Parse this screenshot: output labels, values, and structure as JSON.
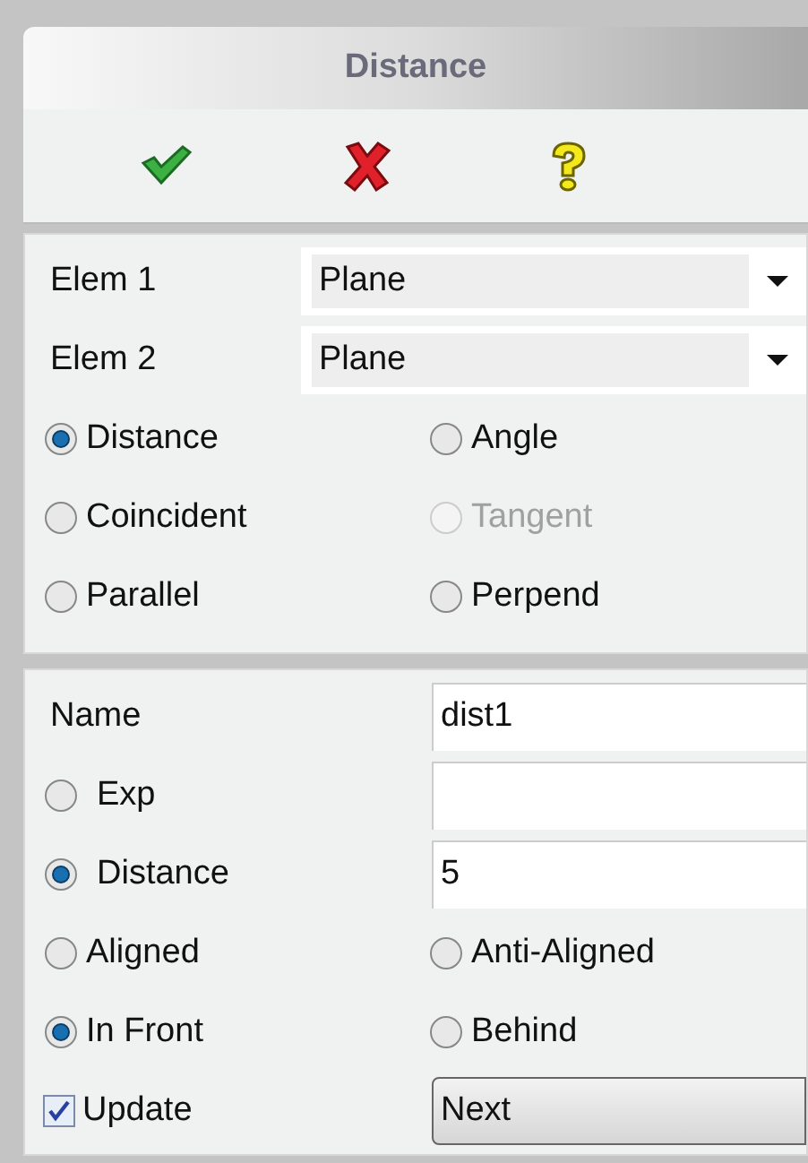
{
  "title": "Distance",
  "actions": [
    {
      "kind": "ok"
    },
    {
      "kind": "cancel"
    },
    {
      "kind": "help"
    }
  ],
  "elements": [
    {
      "label": "Elem 1",
      "value": "Plane"
    },
    {
      "label": "Elem 2",
      "value": "Plane"
    }
  ],
  "constraint_types": [
    {
      "label": "Distance",
      "selected": true,
      "disabled": false
    },
    {
      "label": "Angle",
      "selected": false,
      "disabled": false
    },
    {
      "label": "Coincident",
      "selected": false,
      "disabled": false
    },
    {
      "label": "Tangent",
      "selected": false,
      "disabled": true
    },
    {
      "label": "Parallel",
      "selected": false,
      "disabled": false
    },
    {
      "label": "Perpend",
      "selected": false,
      "disabled": false
    }
  ],
  "rows": [
    {
      "kind": "text",
      "label": "Name",
      "value": "dist1"
    },
    {
      "kind": "radio_field",
      "label": "Exp",
      "selected": false
    },
    {
      "kind": "radio_field",
      "label": "Distance",
      "selected": true,
      "value": "5"
    },
    {
      "kind": "radio_pair",
      "options": [
        {
          "label": "Aligned",
          "selected": false
        },
        {
          "label": "Anti-Aligned",
          "selected": false
        }
      ]
    },
    {
      "kind": "radio_pair",
      "options": [
        {
          "label": "In Front",
          "selected": true
        },
        {
          "label": "Behind",
          "selected": false
        }
      ]
    },
    {
      "kind": "check_button",
      "label": "Update",
      "checked": true,
      "button": "Next"
    }
  ]
}
